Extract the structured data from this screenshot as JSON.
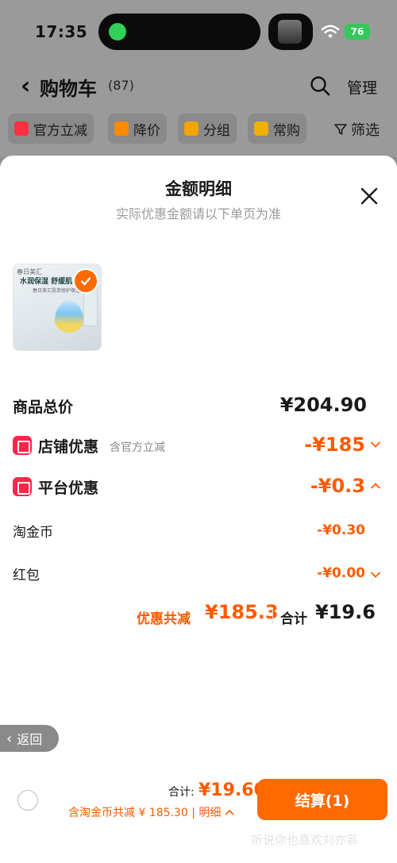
{
  "status": {
    "time": "17:35",
    "battery": "76"
  },
  "nav": {
    "title": "购物车",
    "count": "(87)",
    "manage": "管理"
  },
  "filters": [
    {
      "label": "官方立减",
      "color": "#ff3040"
    },
    {
      "label": "降价",
      "color": "#ff8a00"
    },
    {
      "label": "分组",
      "color": "#f2a400"
    },
    {
      "label": "常购",
      "color": "#f0b000"
    }
  ],
  "filter_screen": "筛选",
  "sheet": {
    "title": "金额明细",
    "subtitle": "实际优惠金额请以下单页为准",
    "product": {
      "brand": "春日美汇",
      "headline": "水润保湿 舒缓肌",
      "sub": "春日美汇肌萃修护保湿"
    },
    "rows": {
      "total_label": "商品总价",
      "total_val": "¥204.90",
      "shop_label": "店铺优惠",
      "shop_note": "含官方立减",
      "shop_val": "-¥185",
      "platform_label": "平台优惠",
      "platform_val": "-¥0.3",
      "coin_label": "淘金币",
      "coin_val": "-¥0.30",
      "redpack_label": "红包",
      "redpack_val": "-¥0.00"
    },
    "summary": {
      "discount_label": "优惠共减",
      "discount_val": "¥185.3",
      "sum_label": "合计",
      "sum_val": "¥19.6"
    }
  },
  "back_pill": "返回",
  "bottom": {
    "total_label": "合计:",
    "total_val": "¥19.60",
    "deduct": "含淘金币共减 ¥ 185.30 | 明细",
    "checkout": "结算(1)",
    "watermark": "听说你也喜欢刘亦菲"
  },
  "colors": {
    "accent": "#ff6a00",
    "accent_text": "#ff5a00",
    "badge_red": "#ff2548"
  }
}
